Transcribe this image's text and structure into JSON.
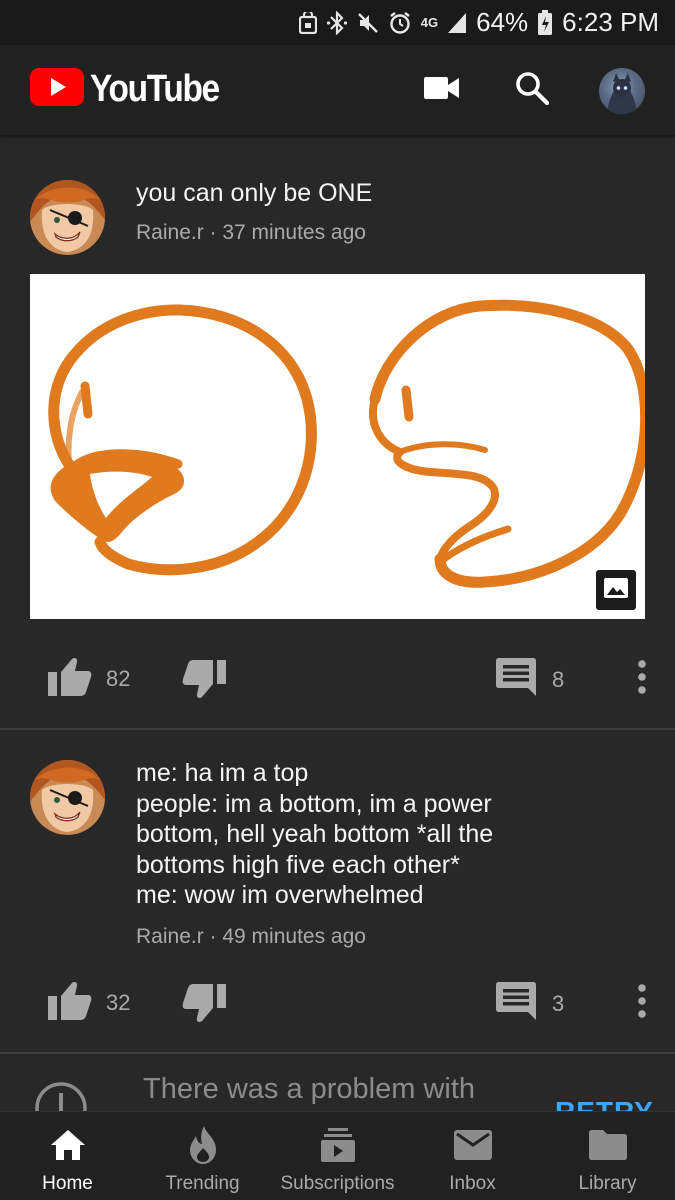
{
  "status_bar": {
    "network": "4G",
    "battery": "64%",
    "time": "6:23 PM",
    "icons": [
      "cart-icon",
      "bluetooth-icon",
      "mute-icon",
      "alarm-icon",
      "network-icon",
      "signal-icon",
      "battery-icon"
    ]
  },
  "header": {
    "app_name": "YouTube",
    "icons": [
      "camera-icon",
      "search-icon",
      "account-avatar"
    ]
  },
  "post": {
    "text": "you can only be ONE",
    "author": "Raine.r",
    "time": "37 minutes ago",
    "meta": "Raine.r · 37 minutes ago",
    "likes": "82",
    "comments": "8",
    "image_badge_icon": "image-icon"
  },
  "post2": {
    "lines": [
      "me: ha im a top",
      "people: im a bottom, im a power",
      "bottom, hell yeah bottom *all the",
      "bottoms high five each other*",
      "me: wow im overwhelmed"
    ],
    "meta": "Raine.r · 49 minutes ago",
    "likes": "32",
    "comments": "3"
  },
  "error": {
    "message": "There was a problem with",
    "retry_label": "RETRY"
  },
  "nav": {
    "home": "Home",
    "trending": "Trending",
    "subscriptions": "Subscriptions",
    "inbox": "Inbox",
    "library": "Library"
  },
  "colors": {
    "background": "#282828",
    "header": "#212121",
    "brand_red": "#ff0000",
    "link_blue": "#3ea6ff",
    "drawing_orange": "#e07a1f"
  }
}
